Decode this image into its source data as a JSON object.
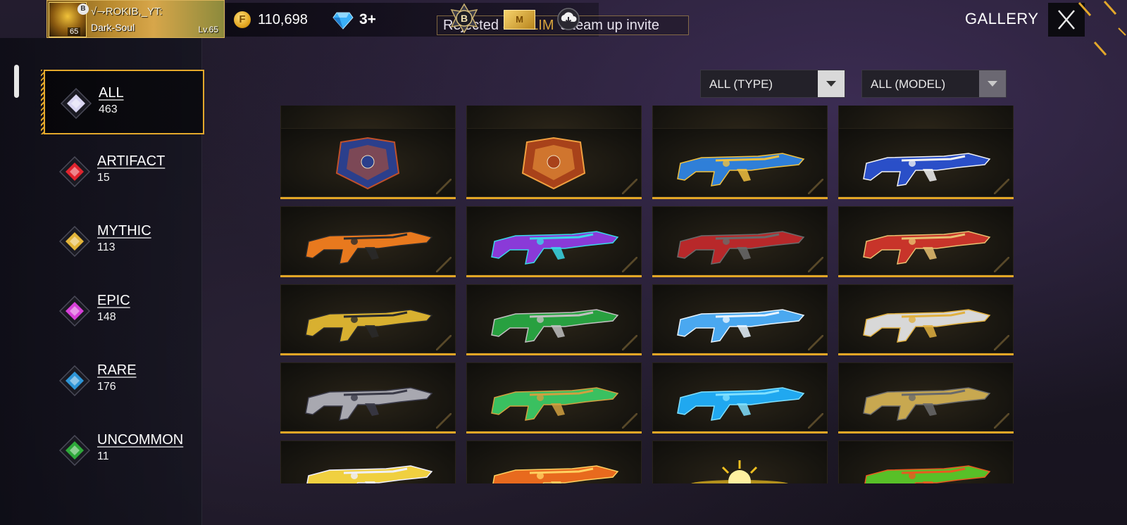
{
  "header": {
    "title": "GALLERY",
    "profile": {
      "name": "√⇁ROKIB,_YT:",
      "guild": "Dark-Soul",
      "level": "Lv.65",
      "avatar_level": "65",
      "rank_pip": "B"
    },
    "currency": {
      "coin_symbol": "F",
      "coins": "110,698",
      "diamonds": "3+"
    },
    "notification": {
      "prefix": "Rejected ",
      "player": "SΞALIM ",
      "suffix": "'s team up invite"
    },
    "gold_card_label": "M",
    "rank_badge_letter": "B"
  },
  "filters": {
    "type": "ALL (TYPE)",
    "model": "ALL (MODEL)"
  },
  "categories": [
    {
      "label": "ALL",
      "count": "463",
      "color": "#d9d6f2",
      "active": true
    },
    {
      "label": "ARTIFACT",
      "count": "15",
      "color": "#e0242e",
      "active": false
    },
    {
      "label": "MYTHIC",
      "count": "113",
      "color": "#e3b53a",
      "active": false
    },
    {
      "label": "EPIC",
      "count": "148",
      "color": "#d640d8",
      "active": false
    },
    {
      "label": "RARE",
      "count": "176",
      "color": "#2e95d6",
      "active": false
    },
    {
      "label": "UNCOMMON",
      "count": "11",
      "color": "#2ea83a",
      "active": false
    }
  ],
  "colors": {
    "accent": "#e3a82b",
    "panel": "#14131c"
  },
  "grid": {
    "rows": [
      {
        "items": [
          {
            "name": "top-partial-item",
            "art": "partial",
            "c1": "#2e5fb0",
            "c2": "#7fd0ff"
          },
          {
            "name": "top-partial-item",
            "art": "partial",
            "c1": "#b06a1e",
            "c2": "#ffd070"
          },
          {
            "name": "top-partial-item",
            "art": "partial",
            "c1": "#3a6fb0",
            "c2": "#9fe0ff"
          },
          {
            "name": "top-partial-item",
            "art": "partial",
            "c1": "#5a80c0",
            "c2": "#c0e0ff"
          }
        ]
      },
      {
        "items": [
          {
            "name": "blue-shield-emblem",
            "art": "shield",
            "c1": "#2b3f8c",
            "c2": "#c0502a"
          },
          {
            "name": "orange-shield-emblem",
            "art": "shield",
            "c1": "#a8421a",
            "c2": "#f0a040"
          },
          {
            "name": "blue-gold-rifle",
            "art": "gun",
            "c1": "#2f7fd8",
            "c2": "#f0c040"
          },
          {
            "name": "skeleton-blue-rifle",
            "art": "gun",
            "c1": "#2a4fc8",
            "c2": "#f2f2f2"
          }
        ]
      },
      {
        "items": [
          {
            "name": "orange-bear-sniper",
            "art": "gun",
            "c1": "#e8791e",
            "c2": "#2a2a2a"
          },
          {
            "name": "purple-cyber-rifle",
            "art": "gun",
            "c1": "#8a3ad8",
            "c2": "#3ad8e8"
          },
          {
            "name": "red-dragon-sniper",
            "art": "gun",
            "c1": "#b8282a",
            "c2": "#6a6a6a"
          },
          {
            "name": "red-gold-smg",
            "art": "gun",
            "c1": "#c8342a",
            "c2": "#e8c070"
          }
        ]
      },
      {
        "items": [
          {
            "name": "gold-black-smg",
            "art": "gun",
            "c1": "#d8b030",
            "c2": "#2a2a2a"
          },
          {
            "name": "green-venom-rifle",
            "art": "gun",
            "c1": "#28a040",
            "c2": "#c0c0c0"
          },
          {
            "name": "ice-blue-shotgun",
            "art": "gun",
            "c1": "#4aa8f0",
            "c2": "#e8f4ff"
          },
          {
            "name": "silver-gold-smg",
            "art": "gun",
            "c1": "#d8d8d8",
            "c2": "#e0b040"
          }
        ]
      },
      {
        "items": [
          {
            "name": "silver-chrome-smg",
            "art": "gun",
            "c1": "#a8a8b0",
            "c2": "#3a3a48"
          },
          {
            "name": "green-gold-crossbow",
            "art": "gun",
            "c1": "#3ac060",
            "c2": "#d0a040"
          },
          {
            "name": "blue-plasma-gun",
            "art": "gun",
            "c1": "#20a8f0",
            "c2": "#80e0ff"
          },
          {
            "name": "gatling-cannon",
            "art": "gun",
            "c1": "#c8a850",
            "c2": "#6a6a6a"
          }
        ]
      },
      {
        "items": [
          {
            "name": "lightning-smg",
            "art": "gun",
            "c1": "#f0d040",
            "c2": "#f0f0ff"
          },
          {
            "name": "flame-rifle",
            "art": "gun",
            "c1": "#e86a1e",
            "c2": "#ffd060"
          },
          {
            "name": "golden-sun-emblem",
            "art": "sun",
            "c1": "#f0c020",
            "c2": "#fff0a0"
          },
          {
            "name": "green-saw-blade",
            "art": "gun",
            "c1": "#58c028",
            "c2": "#e85a20"
          }
        ]
      }
    ]
  }
}
